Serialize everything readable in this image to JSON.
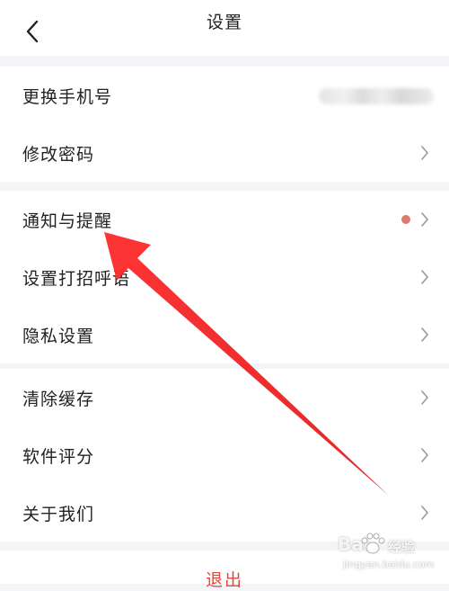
{
  "header": {
    "title": "设置",
    "back_icon": "chevron-left-icon"
  },
  "groups": [
    {
      "items": [
        {
          "label": "更换手机号",
          "value": "",
          "value_blurred": true,
          "chevron": false
        },
        {
          "label": "修改密码",
          "chevron": true
        }
      ]
    },
    {
      "items": [
        {
          "label": "通知与提醒",
          "badge_dot": true,
          "chevron": true
        },
        {
          "label": "设置打招呼语",
          "chevron": true
        },
        {
          "label": "隐私设置",
          "chevron": true
        }
      ]
    },
    {
      "items": [
        {
          "label": "清除缓存",
          "chevron": true
        },
        {
          "label": "软件评分",
          "chevron": true
        },
        {
          "label": "关于我们",
          "chevron": true
        }
      ]
    }
  ],
  "footer": {
    "logout_label": "退出"
  },
  "overlay": {
    "annotation": "red-arrow-pointing-to-notifications",
    "watermark_brand": "Bai",
    "watermark_sub": "经验",
    "watermark_url": "jingyan.baidu.com"
  },
  "colors": {
    "background": "#f4f5f9",
    "surface": "#ffffff",
    "text": "#222222",
    "chevron": "#9a9a9a",
    "badge": "#df7a70",
    "logout": "#e5463b",
    "arrow": "#e53935"
  }
}
